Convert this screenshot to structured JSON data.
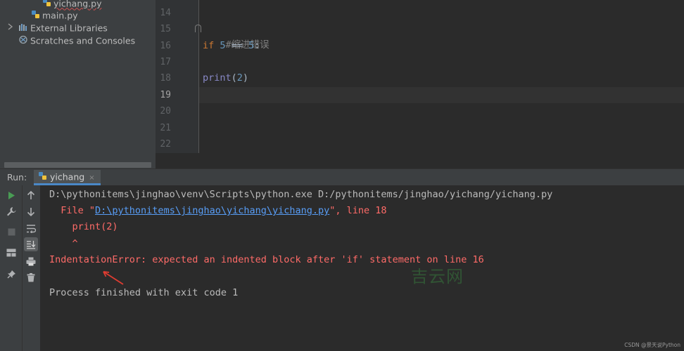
{
  "project_tree": {
    "items": [
      {
        "label": "yichang.py"
      },
      {
        "label": "main.py"
      },
      {
        "label": "External Libraries"
      },
      {
        "label": "Scratches and Consoles"
      }
    ]
  },
  "editor": {
    "line_numbers": [
      "14",
      "15",
      "16",
      "17",
      "18",
      "19",
      "20",
      "21",
      "22"
    ],
    "code": {
      "comment": "#缩进错误",
      "if_kw": "if",
      "if_num1": "5",
      "if_op": " == ",
      "if_num2": "5",
      "if_colon": ":",
      "print_fn": "print",
      "print_open": "(",
      "print_arg": "2",
      "print_close": ")"
    }
  },
  "run_panel": {
    "label": "Run:",
    "tab_label": "yichang",
    "tab_close": "×"
  },
  "console": {
    "cmd_line": "D:\\pythonitems\\jinghao\\venv\\Scripts\\python.exe D:/pythonitems/jinghao/yichang/yichang.py",
    "file_prefix": "  File \"",
    "file_link": "D:\\pythonitems\\jinghao\\yichang\\yichang.py",
    "file_suffix": "\", line 18",
    "code_line": "    print(2)",
    "caret_line": "    ^",
    "error_line": "IndentationError: expected an indented block after 'if' statement on line 16",
    "finish_line": "Process finished with exit code 1"
  },
  "watermark": "吉云网",
  "credit": "CSDN @景天说Python",
  "colors": {
    "error": "#ff6b68",
    "link": "#589df6",
    "keyword": "#cc7832",
    "number": "#6897bb",
    "run_green": "#499c54"
  }
}
